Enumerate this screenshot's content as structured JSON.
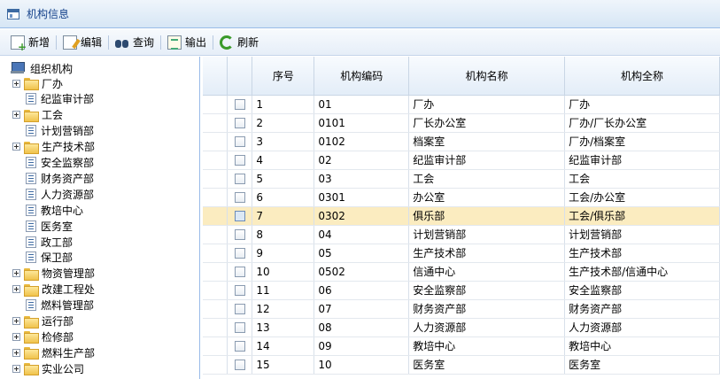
{
  "window": {
    "title": "机构信息"
  },
  "toolbar": {
    "new_label": "新增",
    "edit_label": "编辑",
    "query_label": "查询",
    "export_label": "输出",
    "refresh_label": "刷新"
  },
  "tree": {
    "root": "组织机构",
    "items": [
      {
        "label": "厂办",
        "type": "folder"
      },
      {
        "label": "纪监审计部",
        "type": "leaf"
      },
      {
        "label": "工会",
        "type": "folder"
      },
      {
        "label": "计划营销部",
        "type": "leaf"
      },
      {
        "label": "生产技术部",
        "type": "folder"
      },
      {
        "label": "安全监察部",
        "type": "leaf"
      },
      {
        "label": "财务资产部",
        "type": "leaf"
      },
      {
        "label": "人力资源部",
        "type": "leaf"
      },
      {
        "label": "教培中心",
        "type": "leaf"
      },
      {
        "label": "医务室",
        "type": "leaf"
      },
      {
        "label": "政工部",
        "type": "leaf"
      },
      {
        "label": "保卫部",
        "type": "leaf"
      },
      {
        "label": "物资管理部",
        "type": "folder"
      },
      {
        "label": "改建工程处",
        "type": "folder"
      },
      {
        "label": "燃料管理部",
        "type": "leaf"
      },
      {
        "label": "运行部",
        "type": "folder"
      },
      {
        "label": "检修部",
        "type": "folder"
      },
      {
        "label": "燃料生产部",
        "type": "folder"
      },
      {
        "label": "实业公司",
        "type": "folder"
      }
    ]
  },
  "grid": {
    "columns": [
      "序号",
      "机构编码",
      "机构名称",
      "机构全称"
    ],
    "rows": [
      [
        "1",
        "01",
        "厂办",
        "厂办"
      ],
      [
        "2",
        "0101",
        "厂长办公室",
        "厂办/厂长办公室"
      ],
      [
        "3",
        "0102",
        "档案室",
        "厂办/档案室"
      ],
      [
        "4",
        "02",
        "纪监审计部",
        "纪监审计部"
      ],
      [
        "5",
        "03",
        "工会",
        "工会"
      ],
      [
        "6",
        "0301",
        "办公室",
        "工会/办公室"
      ],
      [
        "7",
        "0302",
        "俱乐部",
        "工会/俱乐部"
      ],
      [
        "8",
        "04",
        "计划营销部",
        "计划营销部"
      ],
      [
        "9",
        "05",
        "生产技术部",
        "生产技术部"
      ],
      [
        "10",
        "0502",
        "信通中心",
        "生产技术部/信通中心"
      ],
      [
        "11",
        "06",
        "安全监察部",
        "安全监察部"
      ],
      [
        "12",
        "07",
        "财务资产部",
        "财务资产部"
      ],
      [
        "13",
        "08",
        "人力资源部",
        "人力资源部"
      ],
      [
        "14",
        "09",
        "教培中心",
        "教培中心"
      ],
      [
        "15",
        "10",
        "医务室",
        "医务室"
      ]
    ],
    "selected_row": 6
  },
  "colors": {
    "selection": "#fbecc0",
    "header_text": "#15428b",
    "border": "#99bbe8"
  }
}
